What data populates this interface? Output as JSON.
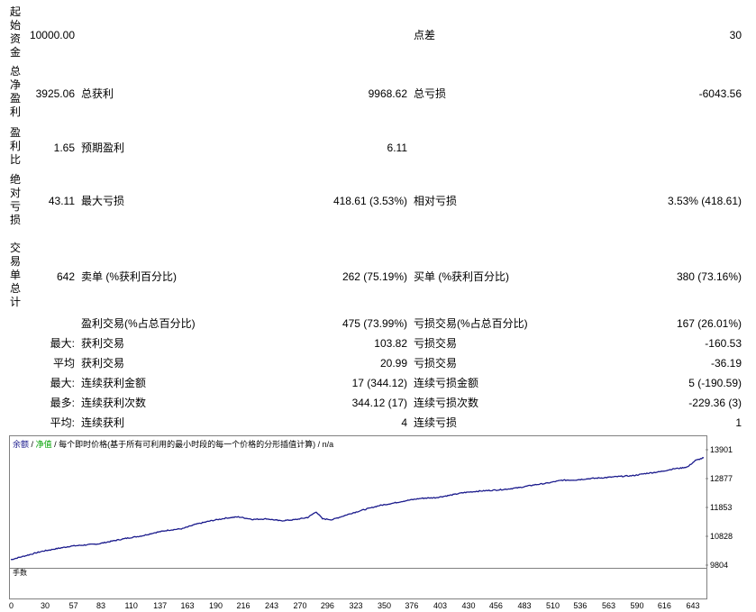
{
  "stats": {
    "initial_deposit": {
      "label": "起始资金",
      "value": "10000.00"
    },
    "spread": {
      "label": "点差",
      "value": "30"
    },
    "total_net_profit": {
      "label": "总净盈利",
      "value": "3925.06"
    },
    "gross_profit": {
      "label": "总获利",
      "value": "9968.62"
    },
    "gross_loss": {
      "label": "总亏损",
      "value": "-6043.56"
    },
    "profit_factor": {
      "label": "盈利比",
      "value": "1.65"
    },
    "expected_payoff": {
      "label": "预期盈利",
      "value": "6.11"
    },
    "absolute_drawdown": {
      "label": "绝对亏损",
      "value": "43.11"
    },
    "maximal_drawdown": {
      "label": "最大亏损",
      "value": "418.61 (3.53%)"
    },
    "relative_drawdown": {
      "label": "相对亏损",
      "value": "3.53% (418.61)"
    },
    "total_trades": {
      "label": "交易单总计",
      "value": "642"
    },
    "short_positions": {
      "label": "卖单 (%获利百分比)",
      "value": "262 (75.19%)"
    },
    "long_positions": {
      "label": "买单 (%获利百分比)",
      "value": "380 (73.16%)"
    },
    "profit_trades": {
      "label": "盈利交易(%占总百分比)",
      "value": "475 (73.99%)"
    },
    "loss_trades": {
      "label": "亏损交易(%占总百分比)",
      "value": "167 (26.01%)"
    },
    "largest_profit_trade": {
      "prefix": "最大:",
      "label": "获利交易",
      "value": "103.82"
    },
    "largest_loss_trade": {
      "label": "亏损交易",
      "value": "-160.53"
    },
    "average_profit_trade": {
      "prefix": "平均",
      "label": "获利交易",
      "value": "20.99"
    },
    "average_loss_trade": {
      "label": "亏损交易",
      "value": "-36.19"
    },
    "max_consec_wins": {
      "prefix": "最大:",
      "label": "连续获利金额",
      "value": "17 (344.12)"
    },
    "max_consec_losses": {
      "label": "连续亏损金额",
      "value": "5 (-190.59)"
    },
    "maximal_consec_profit": {
      "prefix": "最多:",
      "label": "连续获利次数",
      "value": "344.12 (17)"
    },
    "maximal_consec_loss": {
      "label": "连续亏损次数",
      "value": "-229.36 (3)"
    },
    "average_consec_wins": {
      "prefix": "平均:",
      "label": "连续获利",
      "value": "4"
    },
    "average_consec_losses": {
      "label": "连续亏损",
      "value": "1"
    }
  },
  "chart": {
    "legend_balance": "余额",
    "legend_sep1": "/",
    "legend_equity": "净值",
    "legend_rest": "/ 每个即时价格(基于所有可利用的最小时段的每一个价格的分形插值计算) / n/a",
    "volume_label": "手数",
    "balance_color": "#1a1a8c",
    "equity_color": "#00a000",
    "volume_color": "#20b020"
  },
  "chart_data": {
    "type": "line",
    "y_ticks": [
      "13901",
      "12877",
      "11853",
      "10828",
      "9804"
    ],
    "x_ticks": [
      "0",
      "30",
      "57",
      "83",
      "110",
      "137",
      "163",
      "190",
      "216",
      "243",
      "270",
      "296",
      "323",
      "350",
      "376",
      "403",
      "430",
      "456",
      "483",
      "510",
      "536",
      "563",
      "590",
      "616",
      "643"
    ],
    "ylim": [
      9804,
      13901
    ],
    "xlim": [
      0,
      658
    ],
    "series": [
      {
        "values": [
          [
            0,
            10000
          ],
          [
            15,
            10150
          ],
          [
            30,
            10300
          ],
          [
            45,
            10400
          ],
          [
            57,
            10480
          ],
          [
            70,
            10520
          ],
          [
            83,
            10560
          ],
          [
            95,
            10650
          ],
          [
            110,
            10760
          ],
          [
            125,
            10850
          ],
          [
            137,
            10960
          ],
          [
            150,
            11050
          ],
          [
            163,
            11100
          ],
          [
            175,
            11250
          ],
          [
            190,
            11380
          ],
          [
            205,
            11480
          ],
          [
            216,
            11520
          ],
          [
            230,
            11430
          ],
          [
            243,
            11450
          ],
          [
            256,
            11380
          ],
          [
            270,
            11420
          ],
          [
            282,
            11500
          ],
          [
            290,
            11700
          ],
          [
            296,
            11450
          ],
          [
            305,
            11420
          ],
          [
            323,
            11640
          ],
          [
            336,
            11780
          ],
          [
            350,
            11920
          ],
          [
            362,
            12000
          ],
          [
            376,
            12100
          ],
          [
            390,
            12180
          ],
          [
            403,
            12200
          ],
          [
            416,
            12280
          ],
          [
            430,
            12380
          ],
          [
            443,
            12430
          ],
          [
            456,
            12460
          ],
          [
            470,
            12500
          ],
          [
            483,
            12560
          ],
          [
            496,
            12650
          ],
          [
            510,
            12720
          ],
          [
            523,
            12820
          ],
          [
            536,
            12830
          ],
          [
            550,
            12880
          ],
          [
            563,
            12910
          ],
          [
            576,
            12950
          ],
          [
            590,
            12980
          ],
          [
            603,
            13060
          ],
          [
            616,
            13120
          ],
          [
            630,
            13230
          ],
          [
            636,
            13250
          ],
          [
            643,
            13300
          ],
          [
            650,
            13520
          ],
          [
            658,
            13620
          ]
        ]
      }
    ],
    "volume": {
      "type": "bar",
      "description_values": "equal lot per trade"
    }
  }
}
